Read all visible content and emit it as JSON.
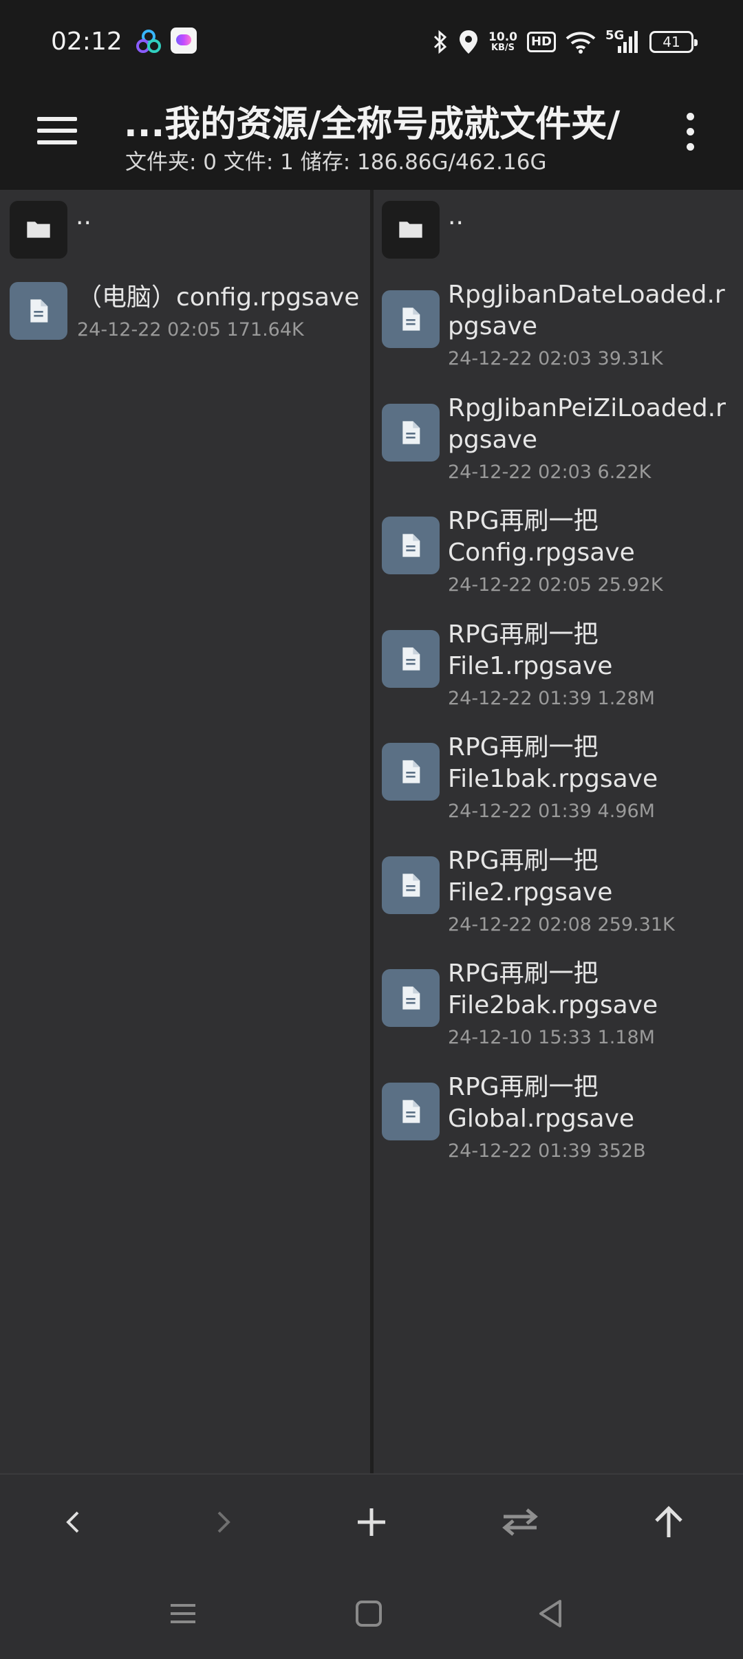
{
  "status": {
    "time": "02:12",
    "speed_value": "10.0",
    "speed_unit": "KB/S",
    "hd": "HD",
    "network": "5G",
    "battery": "41"
  },
  "header": {
    "title": "...我的资源/全称号成就文件夹/",
    "subtitle": "文件夹: 0  文件: 1  储存: 186.86G/462.16G"
  },
  "left_pane": {
    "parent": "..",
    "files": [
      {
        "name": "（电脑）config.rpgsave",
        "meta": "24-12-22 02:05  171.64K"
      }
    ]
  },
  "right_pane": {
    "parent": "..",
    "files": [
      {
        "name": [
          "RpgJibanDateLoaded.r",
          "pgsave"
        ],
        "meta": "24-12-22 02:03  39.31K"
      },
      {
        "name": [
          "RpgJibanPeiZiLoaded.r",
          "pgsave"
        ],
        "meta": "24-12-22 02:03  6.22K"
      },
      {
        "name": [
          "RPG再刷一把",
          "Config.rpgsave"
        ],
        "meta": "24-12-22 02:05  25.92K"
      },
      {
        "name": [
          "RPG再刷一把",
          "File1.rpgsave"
        ],
        "meta": "24-12-22 01:39  1.28M"
      },
      {
        "name": [
          "RPG再刷一把",
          "File1bak.rpgsave"
        ],
        "meta": "24-12-22 01:39  4.96M"
      },
      {
        "name": [
          "RPG再刷一把",
          "File2.rpgsave"
        ],
        "meta": "24-12-22 02:08  259.31K"
      },
      {
        "name": [
          "RPG再刷一把",
          "File2bak.rpgsave"
        ],
        "meta": "24-12-10 15:33  1.18M"
      },
      {
        "name": [
          "RPG再刷一把",
          "Global.rpgsave"
        ],
        "meta": "24-12-22 01:39  352B"
      }
    ]
  },
  "toolbar": {
    "icons": [
      "back-icon",
      "forward-icon",
      "add-icon",
      "swap-icon",
      "up-icon"
    ]
  },
  "colors": {
    "bar_bg": "#1a1a1a",
    "pane_bg": "#303032",
    "file_icon_bg": "#5b7085",
    "folder_icon_bg": "#1c1c1c"
  }
}
